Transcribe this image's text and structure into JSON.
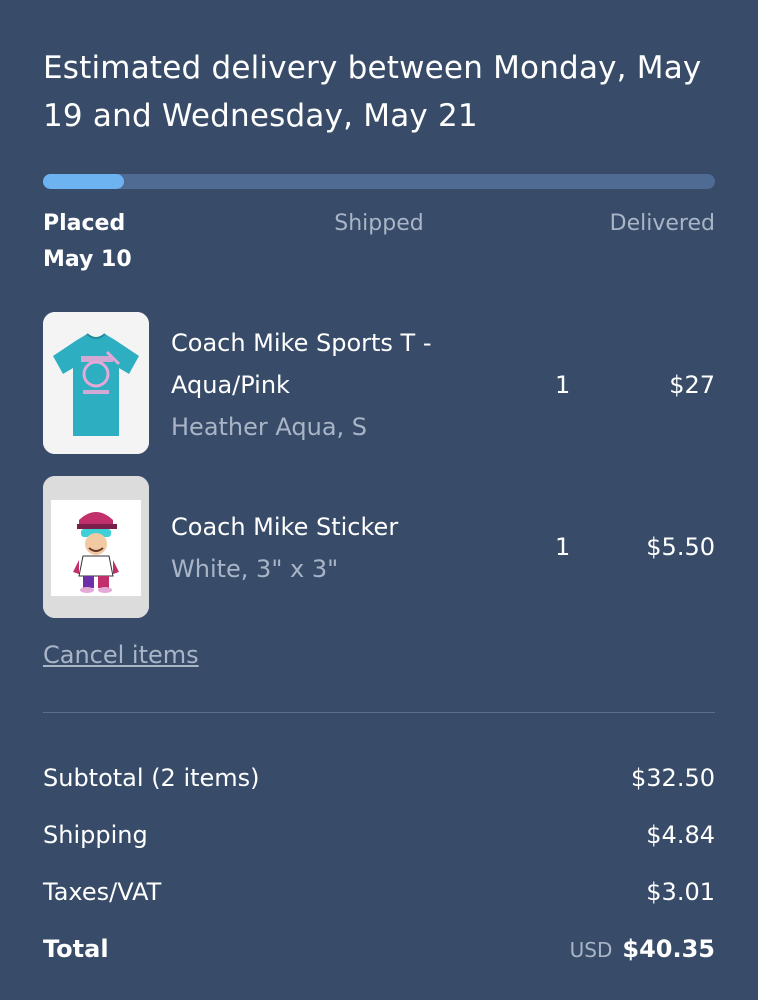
{
  "heading": "Estimated delivery between Monday, May 19 and Wednesday, May 21",
  "progress": {
    "fraction": 0.12,
    "color": "#6db3f2",
    "track_color": "#4f6b93"
  },
  "steps": {
    "placed_label": "Placed",
    "placed_date": "May 10",
    "shipped_label": "Shipped",
    "delivered_label": "Delivered"
  },
  "items": [
    {
      "name": "Coach Mike Sports T - Aqua/Pink",
      "variant": "Heather Aqua, S",
      "qty": "1",
      "price": "$27",
      "thumb_icon": "tshirt-icon"
    },
    {
      "name": "Coach Mike Sticker",
      "variant": "White, 3\" x 3\"",
      "qty": "1",
      "price": "$5.50",
      "thumb_icon": "sticker-icon"
    }
  ],
  "cancel_label": "Cancel items",
  "summary": {
    "subtotal_label": "Subtotal (2 items)",
    "subtotal_value": "$32.50",
    "shipping_label": "Shipping",
    "shipping_value": "$4.84",
    "taxes_label": "Taxes/VAT",
    "taxes_value": "$3.01",
    "total_label": "Total",
    "total_currency": "USD",
    "total_value": "$40.35"
  },
  "colors": {
    "background": "#384c69",
    "muted_text": "#a9b5c6",
    "shirt": "#2eaec1"
  }
}
